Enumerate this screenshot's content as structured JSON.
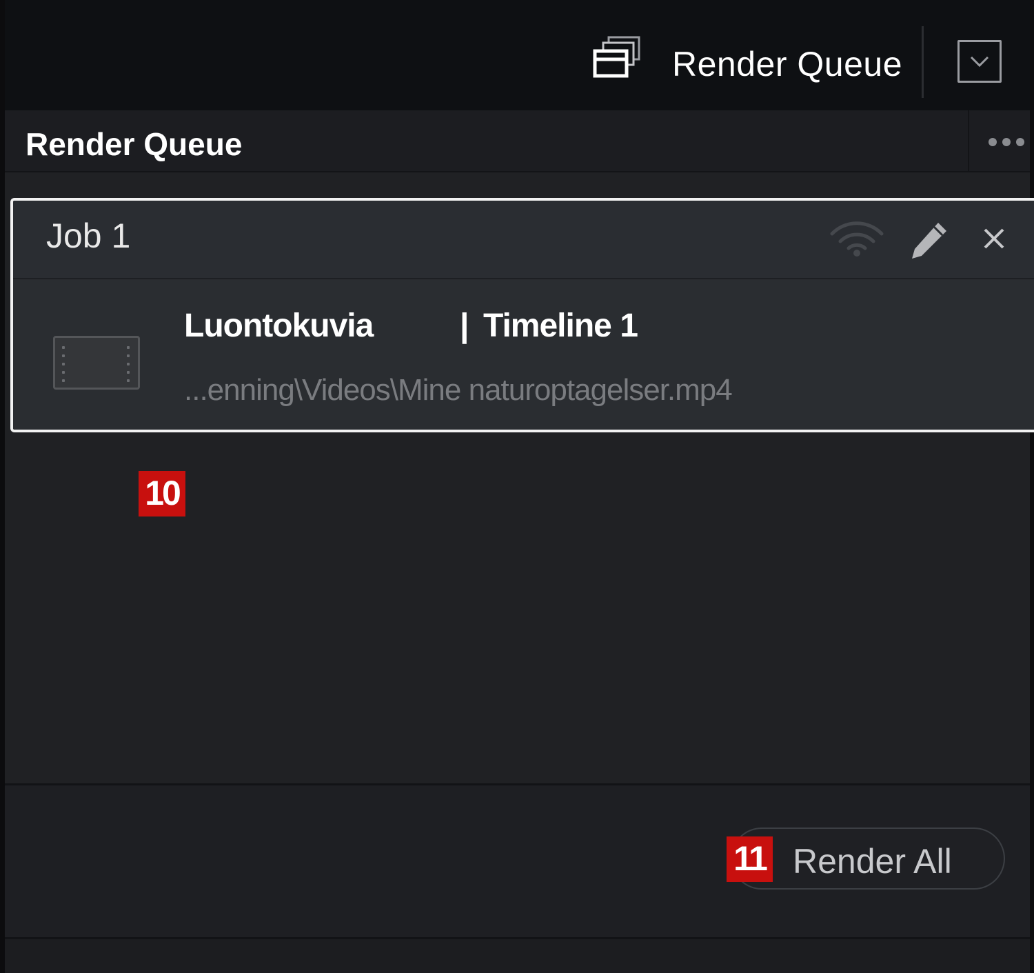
{
  "toolbar": {
    "title": "Render Queue",
    "icon": "render-queue-stack-icon",
    "dropdown_icon": "chevron-down-icon"
  },
  "panel": {
    "title": "Render Queue",
    "options_icon": "more-options-icon"
  },
  "job": {
    "title": "Job 1",
    "project": "Luontokuvia",
    "separator": "|",
    "timeline": "Timeline 1",
    "path": "...enning\\Videos\\Mine naturoptagelser.mp4",
    "icons": [
      "remote-render-icon",
      "edit-pencil-icon",
      "close-icon"
    ]
  },
  "annotations": {
    "badge_10": "10",
    "badge_11": "11"
  },
  "actions": {
    "render_all": "Render All"
  },
  "colors": {
    "background": "#202124",
    "toolbar": "#0e1013",
    "card_border": "#f2f2f2",
    "badge": "#c8100e",
    "muted_text": "#7a7c80"
  }
}
